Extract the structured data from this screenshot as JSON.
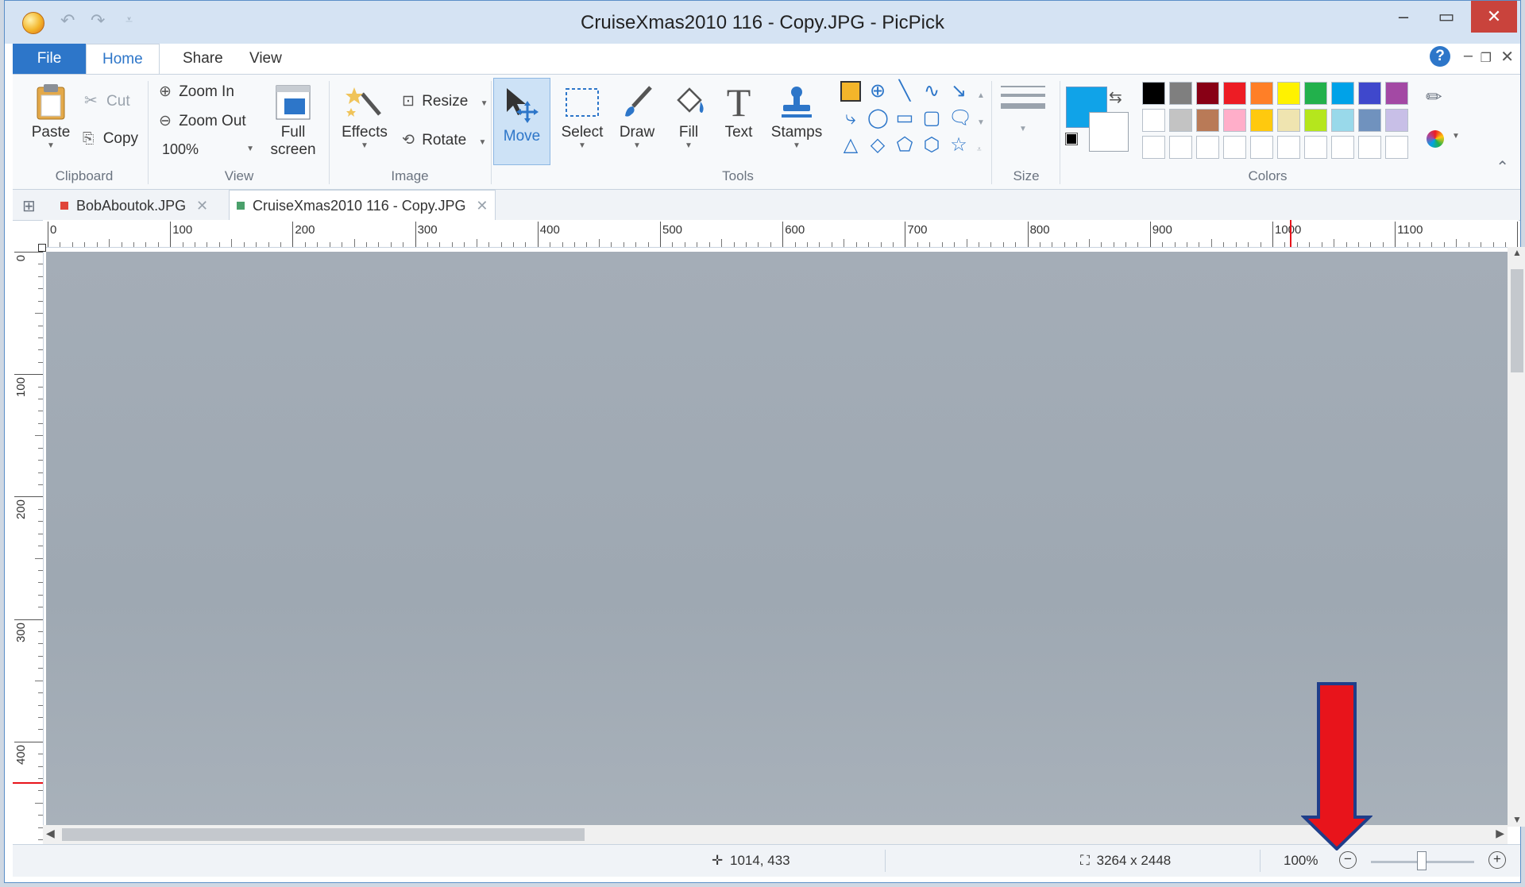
{
  "window": {
    "title": "CruiseXmas2010 116 - Copy.JPG - PicPick",
    "controls": {
      "minimize": "–",
      "maximize": "▭",
      "close": "✕"
    }
  },
  "quick_access": {
    "undo": "↶",
    "redo": "↷",
    "customize": "⩡"
  },
  "ribbon_tabs": [
    {
      "label": "File"
    },
    {
      "label": "Home"
    },
    {
      "label": "Share"
    },
    {
      "label": "View"
    }
  ],
  "ribbon_controls": {
    "help": "?",
    "minimize": "–",
    "restore": "❐",
    "close": "✕",
    "collapse": "⌃"
  },
  "clipboard": {
    "paste": "Paste",
    "cut": "Cut",
    "copy": "Copy",
    "label": "Clipboard"
  },
  "view_group": {
    "zoom_in": "Zoom In",
    "zoom_out": "Zoom Out",
    "zoom_value": "100%",
    "full_screen_1": "Full",
    "full_screen_2": "screen",
    "label": "View"
  },
  "image_group": {
    "effects": "Effects",
    "resize": "Resize",
    "rotate": "Rotate",
    "label": "Image"
  },
  "tools_group": {
    "move": "Move",
    "select": "Select",
    "draw": "Draw",
    "fill": "Fill",
    "text": "Text",
    "stamps": "Stamps",
    "label": "Tools"
  },
  "size_group": {
    "label": "Size"
  },
  "colors_group": {
    "label": "Colors",
    "foreground": "#10a3e8",
    "background": "#ffffff",
    "palette": [
      "#000000",
      "#7f7f7f",
      "#880015",
      "#ed1c24",
      "#ff7f27",
      "#fff200",
      "#22b14c",
      "#00a2e8",
      "#3f48cc",
      "#a349a4",
      "#ffffff",
      "#c3c3c3",
      "#b97a57",
      "#ffaec9",
      "#ffc90e",
      "#efe4b0",
      "#b5e61d",
      "#99d9ea",
      "#7092be",
      "#c8bfe7",
      "#ffffff",
      "#ffffff",
      "#ffffff",
      "#ffffff",
      "#ffffff",
      "#ffffff",
      "#ffffff",
      "#ffffff",
      "#ffffff",
      "#ffffff"
    ]
  },
  "doc_tabs": [
    {
      "label": "BobAboutok.JPG",
      "color": "#e0453a"
    },
    {
      "label": "CruiseXmas2010 116 - Copy.JPG",
      "color": "#4aa06b"
    }
  ],
  "ruler_h": [
    "0",
    "100",
    "200",
    "300",
    "400",
    "500",
    "600",
    "700",
    "800",
    "900",
    "1000",
    "1100",
    "1"
  ],
  "ruler_v": [
    "0",
    "100",
    "200",
    "300",
    "400"
  ],
  "status": {
    "cursor": "1014, 433",
    "dimensions": "3264 x 2448",
    "zoom": "100%"
  }
}
